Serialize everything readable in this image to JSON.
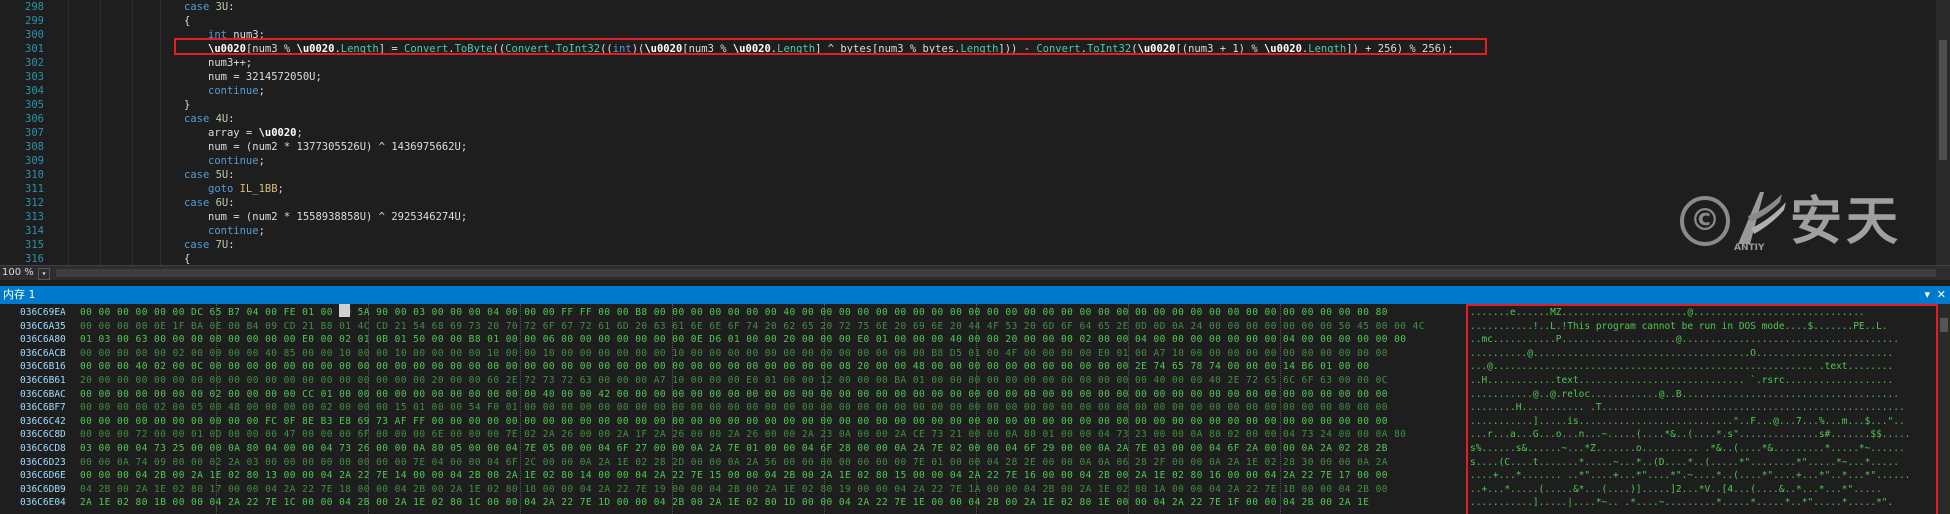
{
  "editor": {
    "line_numbers": [
      "298",
      "299",
      "300",
      "301",
      "302",
      "303",
      "304",
      "305",
      "306",
      "307",
      "308",
      "309",
      "310",
      "311",
      "312",
      "313",
      "314",
      "315",
      "316"
    ],
    "lines": [
      {
        "indent": "",
        "parts": [
          {
            "c": "kw",
            "t": "case "
          },
          {
            "c": "nm",
            "t": "3U"
          },
          {
            "c": "pl",
            "t": ":"
          }
        ]
      },
      {
        "indent": "",
        "parts": [
          {
            "c": "pl",
            "t": "{"
          }
        ]
      },
      {
        "indent": "    ",
        "parts": [
          {
            "c": "kw",
            "t": "int "
          },
          {
            "c": "pl",
            "t": "num3;"
          }
        ]
      },
      {
        "indent": "    ",
        "parts": [
          {
            "c": "bd",
            "t": "\\u0020"
          },
          {
            "c": "pl",
            "t": "[num3 % "
          },
          {
            "c": "bd",
            "t": "\\u0020"
          },
          {
            "c": "pl",
            "t": "."
          },
          {
            "c": "tp",
            "t": "Length"
          },
          {
            "c": "pl",
            "t": "] = "
          },
          {
            "c": "tp",
            "t": "Convert"
          },
          {
            "c": "pl",
            "t": "."
          },
          {
            "c": "tp",
            "t": "ToByte"
          },
          {
            "c": "pl",
            "t": "(("
          },
          {
            "c": "tp",
            "t": "Convert"
          },
          {
            "c": "pl",
            "t": "."
          },
          {
            "c": "tp",
            "t": "ToInt32"
          },
          {
            "c": "pl",
            "t": "(("
          },
          {
            "c": "kw",
            "t": "int"
          },
          {
            "c": "pl",
            "t": ")("
          },
          {
            "c": "bd",
            "t": "\\u0020"
          },
          {
            "c": "pl",
            "t": "[num3 % "
          },
          {
            "c": "bd",
            "t": "\\u0020"
          },
          {
            "c": "pl",
            "t": "."
          },
          {
            "c": "tp",
            "t": "Length"
          },
          {
            "c": "pl",
            "t": "] ^ bytes[num3 % bytes."
          },
          {
            "c": "tp",
            "t": "Length"
          },
          {
            "c": "pl",
            "t": "])) - "
          },
          {
            "c": "tp",
            "t": "Convert"
          },
          {
            "c": "pl",
            "t": "."
          },
          {
            "c": "tp",
            "t": "ToInt32"
          },
          {
            "c": "pl",
            "t": "("
          },
          {
            "c": "bd",
            "t": "\\u0020"
          },
          {
            "c": "pl",
            "t": "[(num3 + 1) % "
          },
          {
            "c": "bd",
            "t": "\\u0020"
          },
          {
            "c": "pl",
            "t": "."
          },
          {
            "c": "tp",
            "t": "Length"
          },
          {
            "c": "pl",
            "t": "]) + 256) % 256);"
          }
        ]
      },
      {
        "indent": "    ",
        "parts": [
          {
            "c": "pl",
            "t": "num3++;"
          }
        ]
      },
      {
        "indent": "    ",
        "parts": [
          {
            "c": "pl",
            "t": "num = 3214572050U;"
          }
        ]
      },
      {
        "indent": "    ",
        "parts": [
          {
            "c": "kw",
            "t": "continue"
          },
          {
            "c": "pl",
            "t": ";"
          }
        ]
      },
      {
        "indent": "",
        "parts": [
          {
            "c": "pl",
            "t": "}"
          }
        ]
      },
      {
        "indent": "",
        "parts": [
          {
            "c": "kw",
            "t": "case "
          },
          {
            "c": "nm",
            "t": "4U"
          },
          {
            "c": "pl",
            "t": ":"
          }
        ]
      },
      {
        "indent": "    ",
        "parts": [
          {
            "c": "pl",
            "t": "array = "
          },
          {
            "c": "bd",
            "t": "\\u0020"
          },
          {
            "c": "pl",
            "t": ";"
          }
        ]
      },
      {
        "indent": "    ",
        "parts": [
          {
            "c": "pl",
            "t": "num = (num2 * 1377305526U) ^ 1436975662U;"
          }
        ]
      },
      {
        "indent": "    ",
        "parts": [
          {
            "c": "kw",
            "t": "continue"
          },
          {
            "c": "pl",
            "t": ";"
          }
        ]
      },
      {
        "indent": "",
        "parts": [
          {
            "c": "kw",
            "t": "case "
          },
          {
            "c": "nm",
            "t": "5U"
          },
          {
            "c": "pl",
            "t": ":"
          }
        ]
      },
      {
        "indent": "    ",
        "parts": [
          {
            "c": "kw",
            "t": "goto "
          },
          {
            "c": "lb",
            "t": "IL_1BB"
          },
          {
            "c": "pl",
            "t": ";"
          }
        ]
      },
      {
        "indent": "",
        "parts": [
          {
            "c": "kw",
            "t": "case "
          },
          {
            "c": "nm",
            "t": "6U"
          },
          {
            "c": "pl",
            "t": ":"
          }
        ]
      },
      {
        "indent": "    ",
        "parts": [
          {
            "c": "pl",
            "t": "num = (num2 * 1558938858U) ^ 2925346274U;"
          }
        ]
      },
      {
        "indent": "    ",
        "parts": [
          {
            "c": "kw",
            "t": "continue"
          },
          {
            "c": "pl",
            "t": ";"
          }
        ]
      },
      {
        "indent": "",
        "parts": [
          {
            "c": "kw",
            "t": "case "
          },
          {
            "c": "nm",
            "t": "7U"
          },
          {
            "c": "pl",
            "t": ":"
          }
        ]
      },
      {
        "indent": "",
        "parts": [
          {
            "c": "pl",
            "t": "{"
          }
        ]
      }
    ],
    "zoom": "100 %",
    "zoom_dropdown": "▾"
  },
  "watermark": {
    "symbol": "©",
    "brand": "ANTIY",
    "chinese": "安天"
  },
  "memory": {
    "title": "内存 1",
    "dropdown": "▾",
    "close": "✕",
    "addresses": [
      "036C69EA",
      "036C6A35",
      "036C6A80",
      "036C6ACB",
      "036C6B16",
      "036C6B61",
      "036C6BAC",
      "036C6BF7",
      "036C6C42",
      "036C6C8D",
      "036C6CD8",
      "036C6D23",
      "036C6D6E",
      "036C6DB9",
      "036C6E04"
    ],
    "hex_rows": [
      "00 00 00 00 00 00 DC 65 B7 04 00 FE 01 00 4D 5A 90 00 03 00 00 00 04 00 00 00 FF FF 00 00 B8 00 00 00 00 00 00 00 40 00 00 00 00 00 00 00 00 00 00 00 00 00 00 00 00 00 00 00 00 00 00 00 00 00 00 00 00 00 00 00 80",
      "00 00 00 00 0E 1F BA 0E 00 B4 09 CD 21 B8 01 4C CD 21 54 68 69 73 20 70 72 6F 67 72 61 6D 20 63 61 6E 6E 6F 74 20 62 65 20 72 75 6E 20 69 6E 20 44 4F 53 20 6D 6F 64 65 2E 0D 0D 0A 24 00 00 00 00 00 00 00 50 45 00 00 4C",
      "01 03 00 63 00 00 00 00 00 00 00 00 E0 00 02 01 0B 01 50 00 00 B8 01 00 00 06 00 00 00 00 00 00 00 0E D6 01 00 00 20 00 00 00 E0 01 00 00 00 40 00 00 20 00 00 00 02 00 00 04 00 00 00 00 00 00 00 04 00 00 00 00 00 00",
      "00 00 00 00 00 02 00 00 00 00 40 85 00 00 10 00 00 10 00 00 00 00 10 00 00 10 00 00 00 00 00 00 10 00 00 00 00 00 00 00 00 00 00 00 00 00 B8 D5 01 00 4F 00 00 00 00 E0 01 00 A7 10 00 00 00 00 00 00 00 00 00 00 00",
      "00 00 00 40 02 00 0C 00 00 00 00 00 00 00 00 00 00 00 00 00 00 00 00 00 00 00 00 00 00 00 00 00 00 00 00 00 00 00 00 00 00 08 20 00 00 48 00 00 00 00 00 00 00 00 00 00 00 2E 74 65 78 74 00 00 00 14 B6 01 00 00",
      "20 00 00 00 00 00 00 00 00 00 00 00 00 00 00 00 00 00 00 20 00 00 60 2E 72 73 72 63 00 00 00 A7 10 00 00 00 E0 01 00 00 12 00 00 00 BA 01 00 00 00 00 00 00 00 00 00 00 00 00 40 00 00 40 2E 72 65 6C 6F 63 00 00 0C",
      "00 00 00 00 00 00 00 02 00 00 00 00 CC 01 00 00 00 00 00 00 00 00 00 00 00 40 00 00 42 00 00 00 00 00 00 00 00 00 00 00 00 00 00 00 00 00 00 00 00 00 00 00 00 00 00 00 00 00 00 00 00 00 00 00 00 00 00 00 00 00 00",
      "00 00 00 00 02 00 05 00 48 00 00 00 00 02 00 00 00 15 01 00 00 54 F0 01 00 00 00 00 00 00 00 00 00 00 00 00 00 00 00 00 00 00 00 00 00 00 00 00 00 00 00 00 00 00 00 00 00 00 00 00 00 00 00 00 00 00 00 00 00 00 00",
      "00 00 00 00 00 00 00 00 00 00 FC 0F 8E B3 E8 69 73 AF FF 00 00 00 00 00 00 00 00 00 00 00 00 00 00 00 00 00 00 00 00 00 00 00 00 00 00 00 00 00 00 00 00 00 00 00 00 00 00 00 00 00 00 00 00 00 00 00 00 00 00 00 00",
      "00 00 00 72 00 00 01 0D 00 00 00 47 00 00 00 6F 00 00 00 6E 00 00 00 7E 02 2A 26 00 00 2A 1F 2A 26 00 00 2A 26 00 00 2A 23 0A 00 00 2A CE 73 21 00 00 0A 80 01 00 00 04 73 23 00 00 0A 80 02 00 00 04 73 24 00 00 0A 80",
      "03 00 00 04 73 25 00 00 0A 80 04 00 00 04 73 26 00 00 0A 80 05 00 00 04 7E 05 00 00 04 6F 27 00 00 0A 2A 7E 01 00 00 04 6F 28 00 00 0A 2A 7E 02 00 00 04 6F 29 00 00 0A 2A 7E 03 00 00 04 6F 2A 00 00 0A 2A 02 28 2B",
      "00 00 0A 74 09 00 00 02 2A 03 00 00 00 00 00 00 00 00 7E 04 00 00 04 6F 2C 00 00 0A 2A 1E 02 28 2D 00 00 0A 2A 56 00 00 00 00 00 00 00 7E 01 00 00 04 28 2E 00 00 0A 0A 06 28 2F 00 00 0A 2A 1E 02 28 30 00 00 0A 2A",
      "00 00 00 04 2B 00 2A 1E 02 80 13 00 00 04 2A 22 7E 14 00 00 04 2B 00 2A 1E 02 80 14 00 00 04 2A 22 7E 15 00 00 04 2B 00 2A 1E 02 80 15 00 00 04 2A 22 7E 16 00 00 04 2B 00 2A 1E 02 80 16 00 00 04 2A 22 7E 17 00 00",
      "04 2B 00 2A 1E 02 80 17 00 00 04 2A 22 7E 18 00 00 04 2B 00 2A 1E 02 80 18 00 00 04 2A 22 7E 19 00 00 04 2B 00 2A 1E 02 80 19 00 00 04 2A 22 7E 1A 00 00 04 2B 00 2A 1E 02 80 1A 00 00 04 2A 22 7E 1B 00 00 04 2B 00",
      "2A 1E 02 80 1B 00 00 04 2A 22 7E 1C 00 00 04 2B 00 2A 1E 02 80 1C 00 00 04 2A 22 7E 1D 00 00 04 2B 00 2A 1E 02 80 1D 00 00 04 2A 22 7E 1E 00 00 04 2B 00 2A 1E 02 80 1E 00 00 04 2A 22 7E 1F 00 00 04 2B 00 2A 1E"
    ],
    "ascii_rows": [
      ".......e......MZ......................@..............................",
      "...........!..L.!This program cannot be run in DOS mode....$.......PE..L.",
      "..mc...........P....................@......................................",
      "..........@......................................O........................",
      "...@........................................................ .text........",
      "..H............text............................. `.rsrc...................",
      "...........@..@.reloc............@..B......................................",
      "........H........... .T.....................................................",
      "...........].....is...........................\"..F...@...7...%...m...$...\"..",
      "...r...a...G...o...n...~.....(....*&..(....*.s\"..............s#.......$$.....",
      "s%......s&......~...*Z.......o.......... .*&..(....*&.........*.....*~......",
      "s....(C....t.......*.....~...*..(D....*..(.....*\"........*\".....*~...*.....",
      "....+...*....... ..*\"....+...*\"....*\".~....*..(....*\"....+...*\"..*...*\"......",
      "..+...*.....(.....&*...(....)].....]2...*V..[4...(....&..*...*...*\".....",
      "...........].....|....*~.. .*....~.........*.....*.....*..*\".....*.....*\"."
    ]
  }
}
